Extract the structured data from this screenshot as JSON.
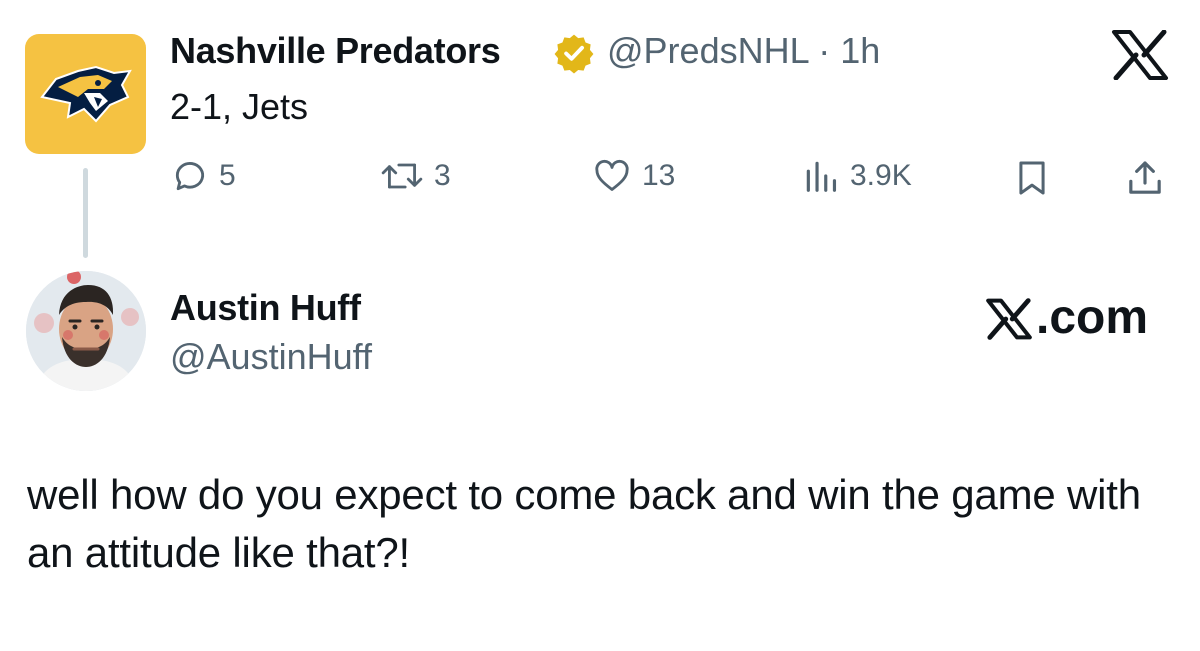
{
  "original_tweet": {
    "display_name": "Nashville Predators",
    "verified": true,
    "handle_time": "@PredsNHL · 1h",
    "text": "2-1, Jets",
    "avatar_icon": "predators-logo-icon",
    "brand_color": "#F5C242",
    "metrics": {
      "replies": "5",
      "reposts": "3",
      "likes": "13",
      "views": "3.9K"
    }
  },
  "reply_tweet": {
    "display_name": "Austin Huff",
    "handle": "@AustinHuff",
    "text": "well how do you expect to come back and win the game with an attitude like that?!"
  },
  "watermark": {
    "text": ".com"
  },
  "colors": {
    "text_primary": "#0F1419",
    "text_secondary": "#536471",
    "verified_gold": "#E2B719",
    "thread_line": "#CFD9DE"
  }
}
